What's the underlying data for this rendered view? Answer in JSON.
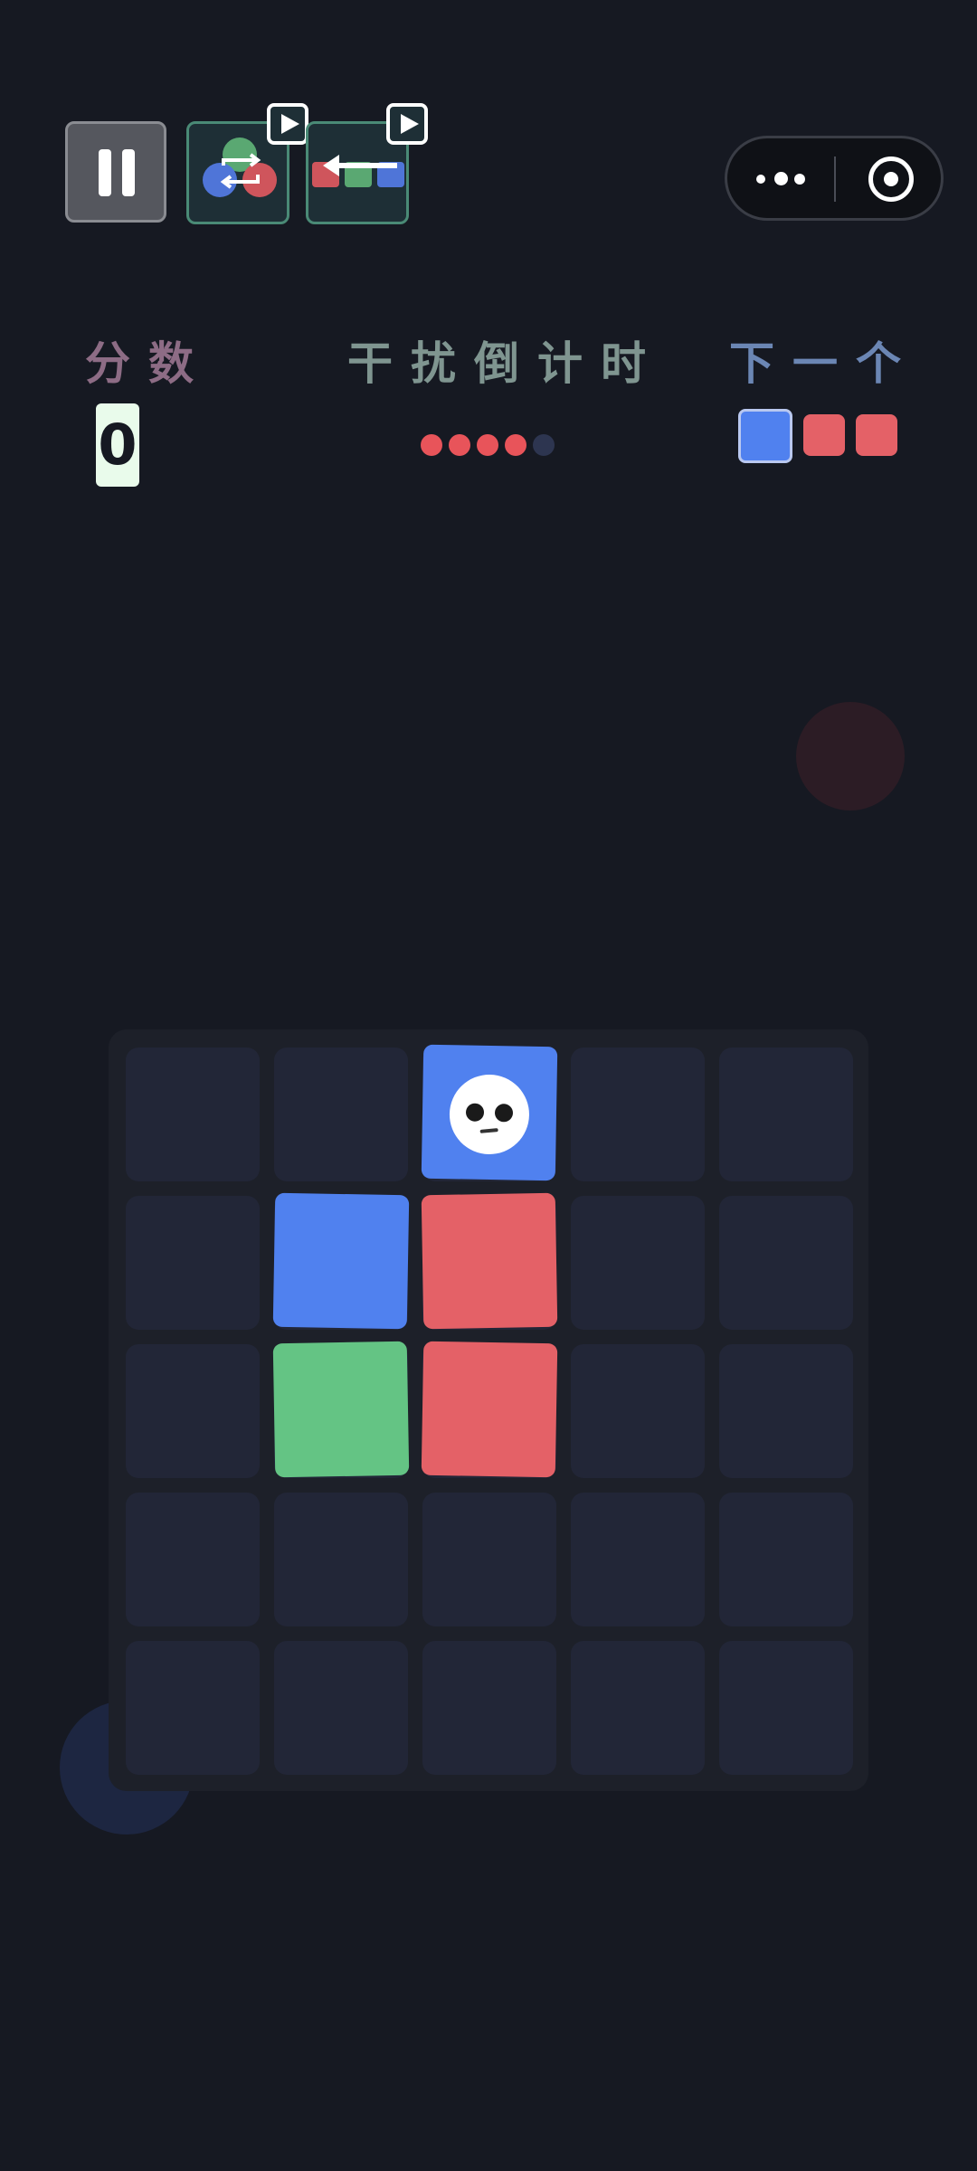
{
  "hud": {
    "score_label": "分数",
    "score_value": "0",
    "countdown_label": "干扰倒计时",
    "countdown": {
      "total": 5,
      "remaining": 4
    },
    "next_label": "下一个",
    "next_blocks": [
      "blue",
      "red",
      "red"
    ]
  },
  "colors": {
    "background": "#161922",
    "blue": "#5081ef",
    "red": "#e46167",
    "green": "#64c484",
    "empty": "#222637",
    "dot_active": "#e8545a",
    "dot_inactive": "#2d3550"
  },
  "toolbar": {
    "pause_icon": "pause-icon",
    "tool1_icon": "color-swap-icon",
    "tool2_icon": "shift-row-icon",
    "badge_icon": "video-play-icon"
  },
  "capsule": {
    "menu_icon": "more-dots-icon",
    "close_icon": "target-circle-icon"
  },
  "board": {
    "rows": 5,
    "cols": 5,
    "blocks": [
      {
        "row": 0,
        "col": 2,
        "color": "blue",
        "face": true
      },
      {
        "row": 1,
        "col": 1,
        "color": "blue",
        "face": false
      },
      {
        "row": 1,
        "col": 2,
        "color": "red",
        "face": false
      },
      {
        "row": 2,
        "col": 1,
        "color": "green",
        "face": false
      },
      {
        "row": 2,
        "col": 2,
        "color": "red",
        "face": false
      }
    ]
  }
}
